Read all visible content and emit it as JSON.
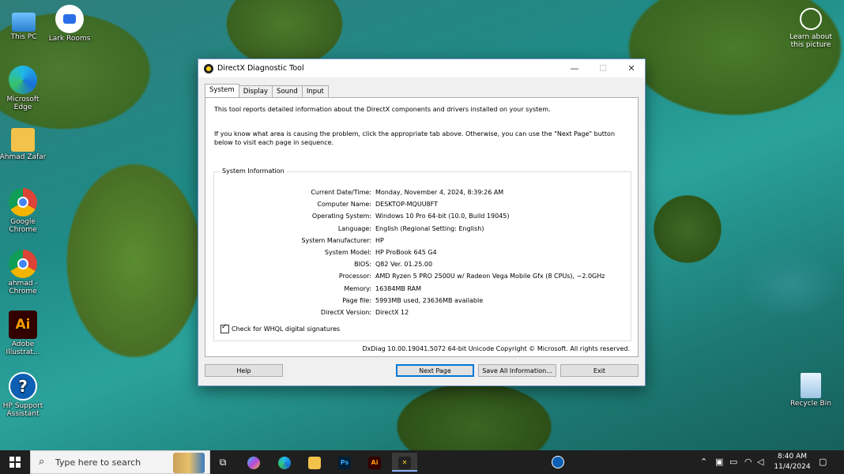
{
  "desktop": {
    "icons": [
      {
        "label": "This PC"
      },
      {
        "label": "Lark Rooms"
      },
      {
        "label": "Microsoft Edge"
      },
      {
        "label": "Ahmad Zafar"
      },
      {
        "label": "Google Chrome"
      },
      {
        "label": "ahmad - Chrome"
      },
      {
        "label": "Adobe Illustrat..."
      },
      {
        "label": "HP Support Assistant"
      },
      {
        "label": "Recycle Bin"
      }
    ],
    "learn_about": "Learn about this picture"
  },
  "window": {
    "title": "DirectX Diagnostic Tool",
    "controls": {
      "minimize": "—",
      "maximize": "☐",
      "close": "✕"
    },
    "tabs": [
      "System",
      "Display",
      "Sound",
      "Input"
    ],
    "active_tab": "System",
    "intro_line1": "This tool reports detailed information about the DirectX components and drivers installed on your system.",
    "intro_line2": "If you know what area is causing the problem, click the appropriate tab above.  Otherwise, you can use the \"Next Page\" button below to visit each page in sequence.",
    "group_title": "System Information",
    "info": [
      {
        "key": "Current Date/Time:",
        "value": "Monday, November 4, 2024, 8:39:26 AM"
      },
      {
        "key": "Computer Name:",
        "value": "DESKTOP-MQUU8FT"
      },
      {
        "key": "Operating System:",
        "value": "Windows 10 Pro 64-bit (10.0, Build 19045)"
      },
      {
        "key": "Language:",
        "value": "English (Regional Setting: English)"
      },
      {
        "key": "System Manufacturer:",
        "value": "HP"
      },
      {
        "key": "System Model:",
        "value": "HP ProBook 645 G4"
      },
      {
        "key": "BIOS:",
        "value": "Q82 Ver. 01.25.00"
      },
      {
        "key": "Processor:",
        "value": "AMD Ryzen 5 PRO 2500U w/ Radeon Vega Mobile Gfx (8 CPUs), ~2.0GHz"
      },
      {
        "key": "Memory:",
        "value": "16384MB RAM"
      },
      {
        "key": "Page file:",
        "value": "5993MB used, 23636MB available"
      },
      {
        "key": "DirectX Version:",
        "value": "DirectX 12"
      }
    ],
    "whql_label": "Check for WHQL digital signatures",
    "whql_checked": true,
    "copyright": "DxDiag 10.00.19041.5072 64-bit Unicode  Copyright © Microsoft. All rights reserved.",
    "buttons": {
      "help": "Help",
      "next_page": "Next Page",
      "save_all": "Save All Information...",
      "exit": "Exit"
    }
  },
  "taskbar": {
    "search_placeholder": "Type here to search",
    "apps": [
      {
        "name": "task-view",
        "glyph": "⧉"
      },
      {
        "name": "copilot",
        "glyph": ""
      },
      {
        "name": "edge",
        "glyph": ""
      },
      {
        "name": "file-explorer",
        "glyph": ""
      },
      {
        "name": "photoshop",
        "glyph": "Ps"
      },
      {
        "name": "illustrator",
        "glyph": "Ai"
      },
      {
        "name": "directx",
        "glyph": "✕"
      }
    ],
    "time": "8:40 AM",
    "date": "11/4/2024",
    "accent_color": "#0078d7"
  }
}
